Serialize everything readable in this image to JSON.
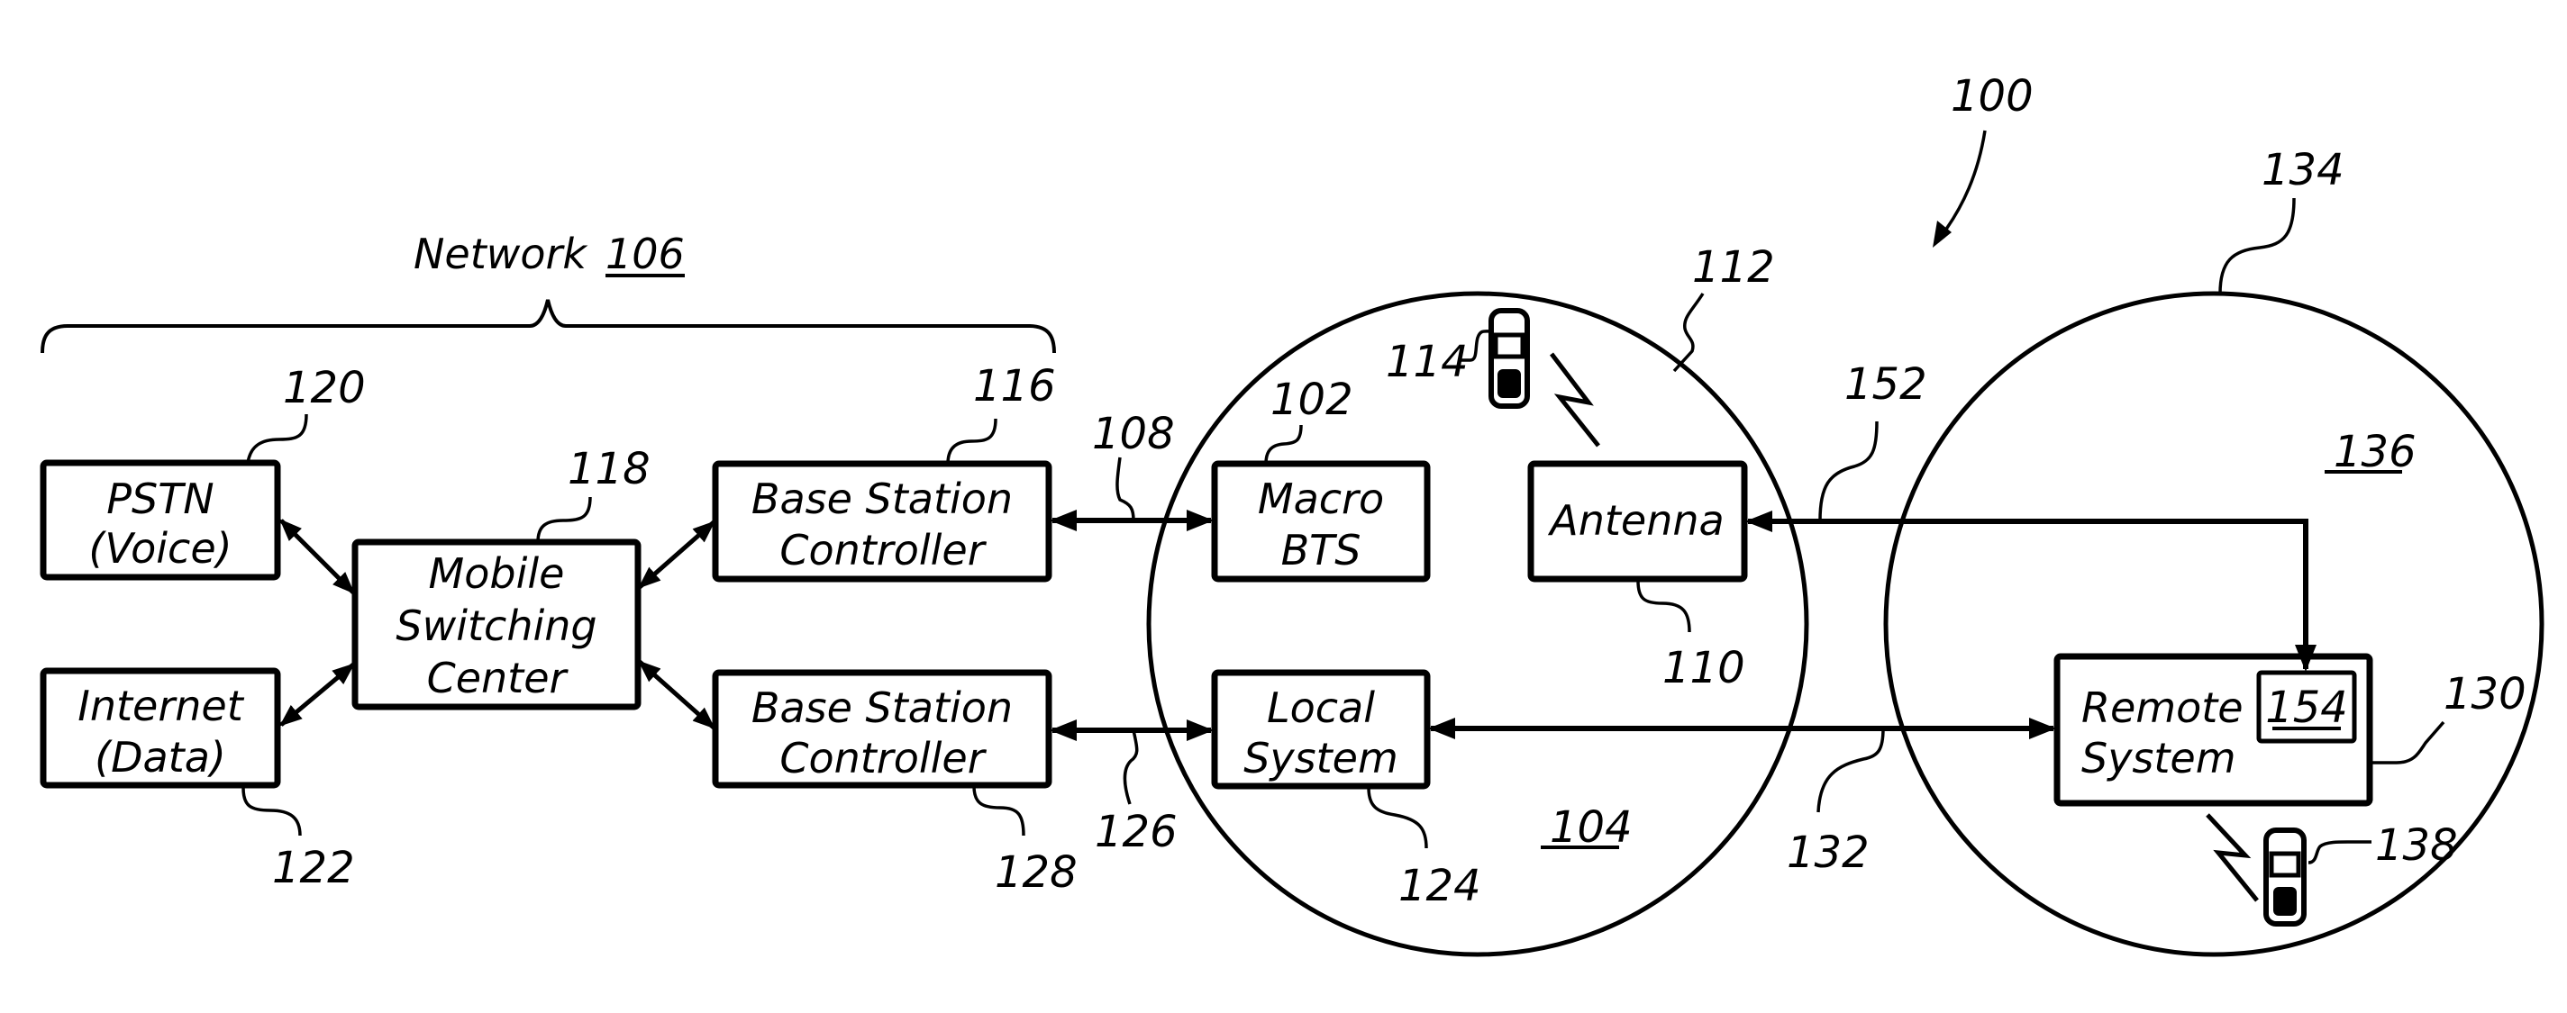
{
  "figure": {
    "reference": "100",
    "network": {
      "label": "Network",
      "ref": "106"
    }
  },
  "blocks": {
    "pstn": {
      "line1": "PSTN",
      "line2": "(Voice)",
      "ref": "120"
    },
    "internet": {
      "line1": "Internet",
      "line2": "(Data)",
      "ref": "122"
    },
    "msc": {
      "line1": "Mobile",
      "line2": "Switching",
      "line3": "Center",
      "ref": "118"
    },
    "bsc_top": {
      "line1": "Base Station",
      "line2": "Controller",
      "ref": "116"
    },
    "bsc_bottom": {
      "line1": "Base Station",
      "line2": "Controller",
      "ref": "128"
    },
    "macro_bts": {
      "line1": "Macro",
      "line2": "BTS",
      "ref": "102"
    },
    "antenna": {
      "line1": "Antenna",
      "ref": "110"
    },
    "local_system": {
      "line1": "Local",
      "line2": "System",
      "ref": "124"
    },
    "remote_system": {
      "line1": "Remote",
      "line2": "System",
      "ref": "130",
      "inner_ref": "154"
    }
  },
  "links": {
    "bsc_to_macro": "108",
    "bsc_to_local": "126",
    "local_to_remote": "132",
    "remote_to_antenna": "152"
  },
  "cells": {
    "macro_cell": {
      "ref": "112",
      "area_ref": "104"
    },
    "remote_cell": {
      "ref": "134",
      "area_ref": "136"
    }
  },
  "devices": {
    "mobile_macro": {
      "ref": "114"
    },
    "mobile_remote": {
      "ref": "138"
    }
  }
}
